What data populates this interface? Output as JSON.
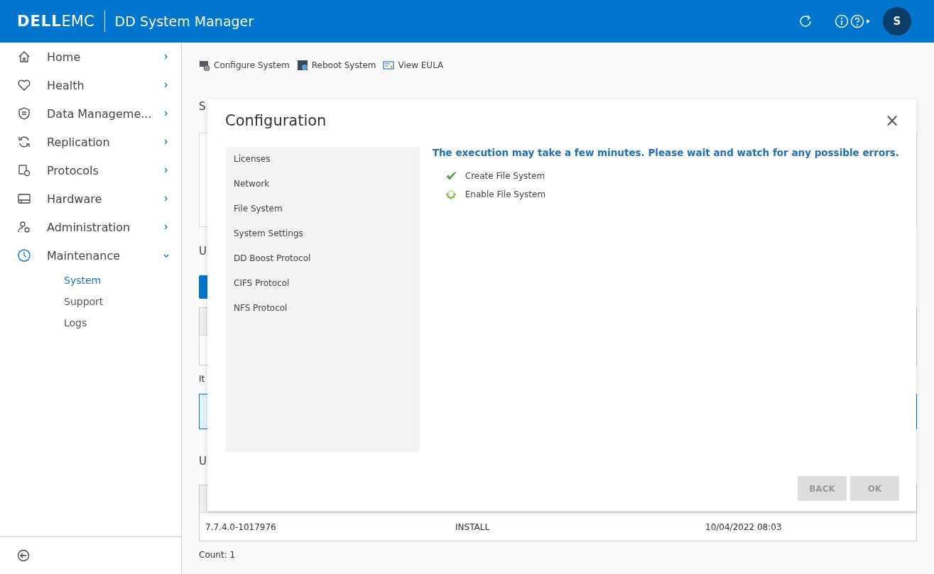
{
  "header": {
    "logo_dell": "DELL",
    "logo_emc": "EMC",
    "app_title": "DD System Manager",
    "avatar": "S"
  },
  "sidebar": {
    "items": [
      {
        "label": "Home",
        "expanded": false
      },
      {
        "label": "Health",
        "expanded": false
      },
      {
        "label": "Data Manageme...",
        "expanded": false
      },
      {
        "label": "Replication",
        "expanded": false
      },
      {
        "label": "Protocols",
        "expanded": false
      },
      {
        "label": "Hardware",
        "expanded": false
      },
      {
        "label": "Administration",
        "expanded": false
      },
      {
        "label": "Maintenance",
        "expanded": true,
        "children": [
          {
            "label": "System",
            "selected": true
          },
          {
            "label": "Support",
            "selected": false
          },
          {
            "label": "Logs",
            "selected": false
          }
        ]
      }
    ]
  },
  "toolbar": {
    "actions": [
      "Configure System",
      "Reboot System",
      "View EULA"
    ]
  },
  "background": {
    "section_1_title": "S",
    "section_2_title": "U",
    "items_label": "It",
    "section_3_title": "U",
    "table": {
      "rows": [
        [
          "7.7.4.0-1017976",
          "INSTALL",
          "10/04/2022 08:03"
        ]
      ]
    },
    "count": "Count: 1"
  },
  "dialog": {
    "title": "Configuration",
    "close": "×",
    "steps": [
      {
        "label": "Licenses"
      },
      {
        "label": "Network"
      },
      {
        "label": "File System"
      },
      {
        "label": "System Settings"
      },
      {
        "label": "DD Boost Protocol"
      },
      {
        "label": "CIFS Protocol"
      },
      {
        "label": "NFS Protocol"
      }
    ],
    "message": "The execution may take a few minutes. Please wait and watch for any possible errors.",
    "tasks": [
      {
        "label": "Create File System",
        "done": true
      },
      {
        "label": "Enable File System",
        "done": false
      }
    ],
    "buttons": [
      {
        "label": "BACK",
        "disabled": true
      },
      {
        "label": "OK",
        "disabled": true
      }
    ]
  }
}
